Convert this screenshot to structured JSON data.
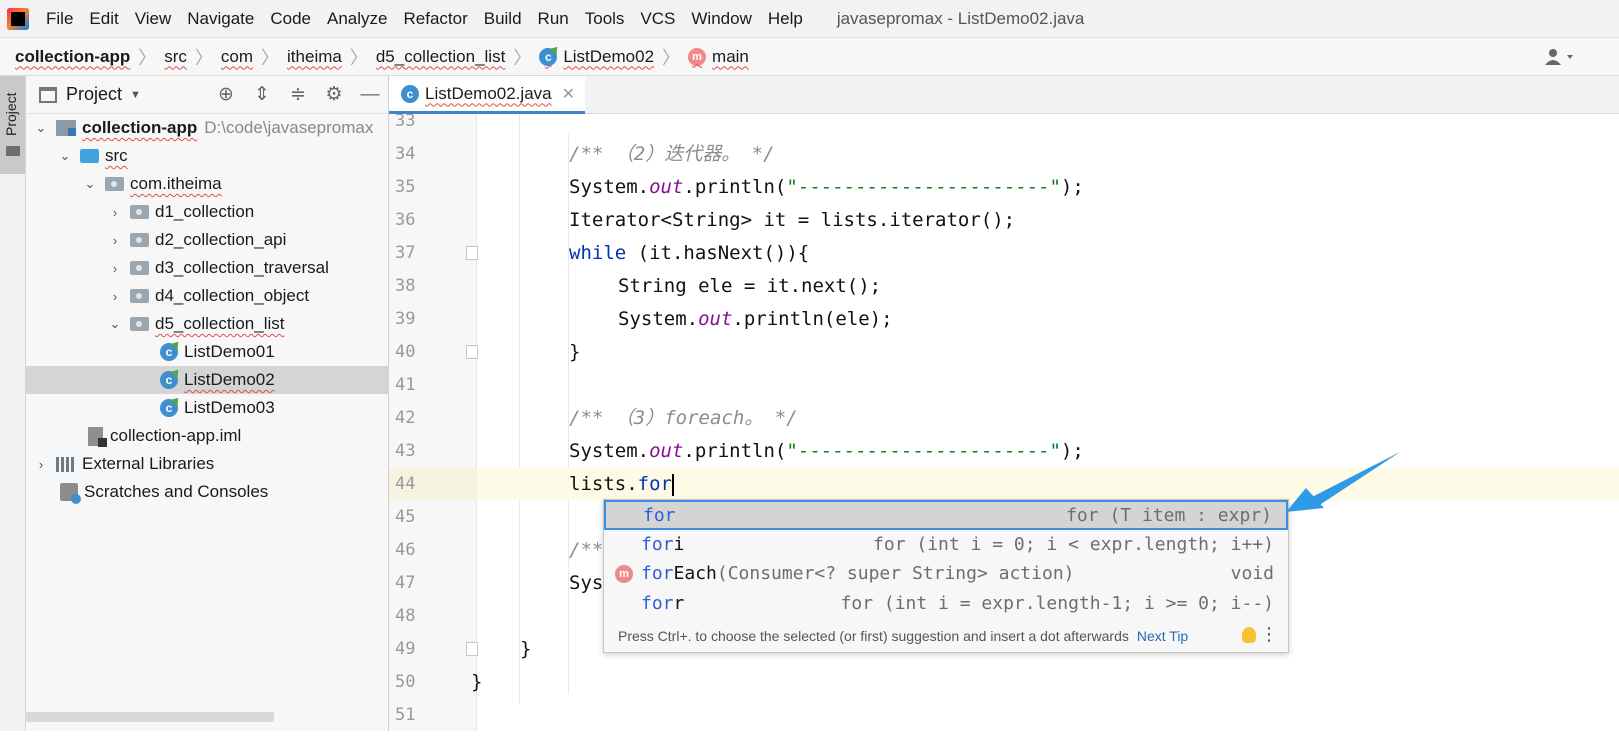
{
  "menu": {
    "items": [
      "File",
      "Edit",
      "View",
      "Navigate",
      "Code",
      "Analyze",
      "Refactor",
      "Build",
      "Run",
      "Tools",
      "VCS",
      "Window",
      "Help"
    ],
    "window_title": "javasepromax - ListDemo02.java"
  },
  "breadcrumb": {
    "project": "collection-app",
    "src": "src",
    "com": "com",
    "itheima": "itheima",
    "package": "d5_collection_list",
    "class": "ListDemo02",
    "method": "main",
    "class_icon": "c-class-icon",
    "method_icon": "m-method-icon"
  },
  "tool_stripe": {
    "label": "Project"
  },
  "project_panel": {
    "title": "Project",
    "tree": {
      "root": "collection-app",
      "root_path": "D:\\code\\javasepromax",
      "src": "src",
      "package": "com.itheima",
      "sub1": "d1_collection",
      "sub2": "d2_collection_api",
      "sub3": "d3_collection_traversal",
      "sub4": "d4_collection_object",
      "sub5": "d5_collection_list",
      "file1": "ListDemo01",
      "file2": "ListDemo02",
      "file3": "ListDemo03",
      "iml": "collection-app.iml",
      "libs": "External Libraries",
      "scratches": "Scratches and Consoles"
    }
  },
  "editor": {
    "tab_label": "ListDemo02.java",
    "lines": {
      "n33": "33",
      "n34": "34",
      "n35": "35",
      "n36": "36",
      "n37": "37",
      "n38": "38",
      "n39": "39",
      "n40": "40",
      "n41": "41",
      "n42": "42",
      "n43": "43",
      "n44": "44",
      "n45": "45",
      "n46": "46",
      "n47": "47",
      "n48": "48",
      "n49": "49",
      "n50": "50",
      "n51": "51"
    },
    "code": {
      "l34_comment": "/** （2）迭代器。 */",
      "l35_a": "System.",
      "l35_b": "out",
      "l35_c": ".println(",
      "l35_d": "\"----------------------\"",
      "l35_e": ");",
      "l36": "Iterator<String> it = lists.iterator();",
      "l37_kw": "while",
      "l37_rest": " (it.hasNext()){",
      "l38": "String ele = it.next();",
      "l39_a": "System.",
      "l39_b": "out",
      "l39_c": ".println(ele);",
      "l40": "}",
      "l42_comment": "/** （3）foreach。 */",
      "l43_a": "System.",
      "l43_b": "out",
      "l43_c": ".println(",
      "l43_d": "\"----------------------\"",
      "l43_e": ");",
      "l44_a": "lists.",
      "l44_b": "for",
      "l46_partial": "/**",
      "l47_partial": "Sys",
      "l49": "}",
      "l50": "}"
    }
  },
  "completion": {
    "items": [
      {
        "name_match": "for",
        "name_rest": "",
        "tail": "for (T item : expr)"
      },
      {
        "name_match": "for",
        "name_rest": "i",
        "tail": "for (int i = 0; i < expr.length; i++)"
      },
      {
        "name_match": "for",
        "name_rest": "Each",
        "sig": "(Consumer<? super String> action)",
        "tail": "void"
      },
      {
        "name_match": "for",
        "name_rest": "r",
        "tail": "for (int i = expr.length-1; i >= 0; i--)"
      }
    ],
    "footer_hint": "Press Ctrl+. to choose the selected (or first) suggestion and insert a dot afterwards",
    "footer_link": "Next Tip"
  },
  "colors": {
    "accent": "#3b8ee0",
    "keyword": "#0033b3",
    "string": "#067d17",
    "field": "#871094",
    "comment": "#8c8c8c",
    "annotation_arrow": "#2f9be8"
  }
}
